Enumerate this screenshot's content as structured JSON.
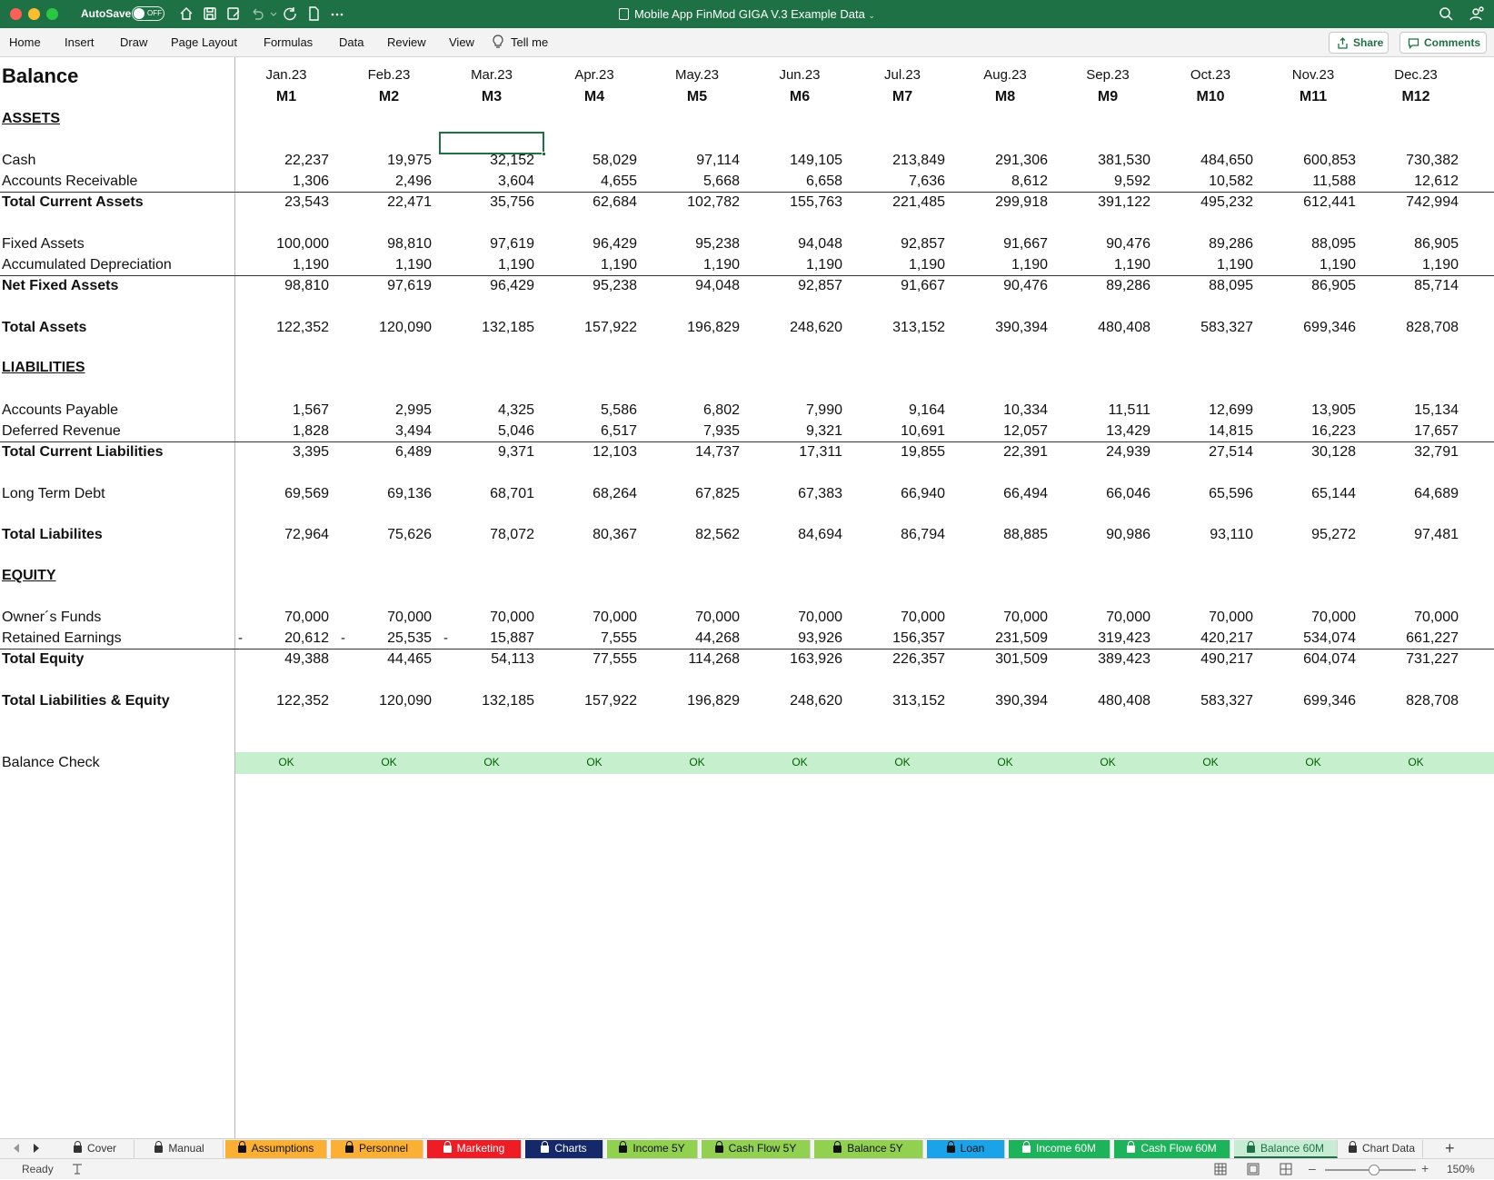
{
  "titlebar": {
    "autosave_label": "AutoSave",
    "autosave_state": "OFF",
    "document_title": "Mobile App FinMod GIGA V.3 Example Data",
    "bg_color": "#1e7145"
  },
  "ribbon": {
    "tabs": [
      "Home",
      "Insert",
      "Draw",
      "Page Layout",
      "Formulas",
      "Data",
      "Review",
      "View"
    ],
    "tell_me": "Tell me",
    "share_label": "Share",
    "comments_label": "Comments"
  },
  "sheet": {
    "title": "Balance",
    "months": [
      "Jan.23",
      "Feb.23",
      "Mar.23",
      "Apr.23",
      "May.23",
      "Jun.23",
      "Jul.23",
      "Aug.23",
      "Sep.23",
      "Oct.23",
      "Nov.23",
      "Dec.23"
    ],
    "month_ids": [
      "M1",
      "M2",
      "M3",
      "M4",
      "M5",
      "M6",
      "M7",
      "M8",
      "M9",
      "M10",
      "M11",
      "M12"
    ],
    "sections": {
      "assets": "ASSETS",
      "liabilities": "LIABILITIES",
      "equity": "EQUITY"
    },
    "rows": {
      "cash": {
        "label": "Cash",
        "values": [
          "22,237",
          "19,975",
          "32,152",
          "58,029",
          "97,114",
          "149,105",
          "213,849",
          "291,306",
          "381,530",
          "484,650",
          "600,853",
          "730,382"
        ]
      },
      "ar": {
        "label": "Accounts Receivable",
        "values": [
          "1,306",
          "2,496",
          "3,604",
          "4,655",
          "5,668",
          "6,658",
          "7,636",
          "8,612",
          "9,592",
          "10,582",
          "11,588",
          "12,612"
        ]
      },
      "tca": {
        "label": "Total Current Assets",
        "values": [
          "23,543",
          "22,471",
          "35,756",
          "62,684",
          "102,782",
          "155,763",
          "221,485",
          "299,918",
          "391,122",
          "495,232",
          "612,441",
          "742,994"
        ]
      },
      "fa": {
        "label": "Fixed Assets",
        "values": [
          "100,000",
          "98,810",
          "97,619",
          "96,429",
          "95,238",
          "94,048",
          "92,857",
          "91,667",
          "90,476",
          "89,286",
          "88,095",
          "86,905"
        ]
      },
      "ad": {
        "label": "Accumulated Depreciation",
        "values": [
          "1,190",
          "1,190",
          "1,190",
          "1,190",
          "1,190",
          "1,190",
          "1,190",
          "1,190",
          "1,190",
          "1,190",
          "1,190",
          "1,190"
        ]
      },
      "nfa": {
        "label": "Net Fixed Assets",
        "values": [
          "98,810",
          "97,619",
          "96,429",
          "95,238",
          "94,048",
          "92,857",
          "91,667",
          "90,476",
          "89,286",
          "88,095",
          "86,905",
          "85,714"
        ]
      },
      "ta": {
        "label": "Total Assets",
        "values": [
          "122,352",
          "120,090",
          "132,185",
          "157,922",
          "196,829",
          "248,620",
          "313,152",
          "390,394",
          "480,408",
          "583,327",
          "699,346",
          "828,708"
        ]
      },
      "ap": {
        "label": "Accounts Payable",
        "values": [
          "1,567",
          "2,995",
          "4,325",
          "5,586",
          "6,802",
          "7,990",
          "9,164",
          "10,334",
          "11,511",
          "12,699",
          "13,905",
          "15,134"
        ]
      },
      "dr": {
        "label": "Deferred Revenue",
        "values": [
          "1,828",
          "3,494",
          "5,046",
          "6,517",
          "7,935",
          "9,321",
          "10,691",
          "12,057",
          "13,429",
          "14,815",
          "16,223",
          "17,657"
        ]
      },
      "tcl": {
        "label": "Total Current Liabilities",
        "values": [
          "3,395",
          "6,489",
          "9,371",
          "12,103",
          "14,737",
          "17,311",
          "19,855",
          "22,391",
          "24,939",
          "27,514",
          "30,128",
          "32,791"
        ]
      },
      "ltd": {
        "label": "Long Term Debt",
        "values": [
          "69,569",
          "69,136",
          "68,701",
          "68,264",
          "67,825",
          "67,383",
          "66,940",
          "66,494",
          "66,046",
          "65,596",
          "65,144",
          "64,689"
        ]
      },
      "tl": {
        "label": "Total Liabilites",
        "values": [
          "72,964",
          "75,626",
          "78,072",
          "80,367",
          "82,562",
          "84,694",
          "86,794",
          "88,885",
          "90,986",
          "93,110",
          "95,272",
          "97,481"
        ]
      },
      "of": {
        "label": "Owner´s Funds",
        "values": [
          "70,000",
          "70,000",
          "70,000",
          "70,000",
          "70,000",
          "70,000",
          "70,000",
          "70,000",
          "70,000",
          "70,000",
          "70,000",
          "70,000"
        ]
      },
      "re": {
        "label": "Retained Earnings",
        "values": [
          "20,612",
          "25,535",
          "15,887",
          "7,555",
          "44,268",
          "93,926",
          "156,357",
          "231,509",
          "319,423",
          "420,217",
          "534,074",
          "661,227"
        ],
        "negative_marks": [
          "-",
          "-",
          "-"
        ]
      },
      "te": {
        "label": "Total Equity",
        "values": [
          "49,388",
          "44,465",
          "54,113",
          "77,555",
          "114,268",
          "163,926",
          "226,357",
          "301,509",
          "389,423",
          "490,217",
          "604,074",
          "731,227"
        ]
      },
      "tle": {
        "label": "Total Liabilities & Equity",
        "values": [
          "122,352",
          "120,090",
          "132,185",
          "157,922",
          "196,829",
          "248,620",
          "313,152",
          "390,394",
          "480,408",
          "583,327",
          "699,346",
          "828,708"
        ]
      },
      "bc": {
        "label": "Balance Check",
        "values": [
          "OK",
          "OK",
          "OK",
          "OK",
          "OK",
          "OK",
          "OK",
          "OK",
          "OK",
          "OK",
          "OK",
          "OK"
        ]
      }
    },
    "check_color": "#c6efce",
    "check_text_color": "#006100"
  },
  "sheet_tabs": [
    {
      "label": "Cover",
      "color": "#f3f3f3",
      "text": "#333",
      "locked": true
    },
    {
      "label": "Manual",
      "color": "#f3f3f3",
      "text": "#333",
      "locked": true
    },
    {
      "label": "Assumptions",
      "color": "#fbb034",
      "text": "#111",
      "locked": true
    },
    {
      "label": "Personnel",
      "color": "#fbb034",
      "text": "#111",
      "locked": true
    },
    {
      "label": "Marketing",
      "color": "#ee1c25",
      "text": "#fff",
      "locked": true
    },
    {
      "label": "Charts",
      "color": "#14286a",
      "text": "#fff",
      "locked": true
    },
    {
      "label": "Income 5Y",
      "color": "#92d050",
      "text": "#111",
      "locked": true
    },
    {
      "label": "Cash Flow 5Y",
      "color": "#92d050",
      "text": "#111",
      "locked": true
    },
    {
      "label": "Balance 5Y",
      "color": "#92d050",
      "text": "#111",
      "locked": true
    },
    {
      "label": "Loan",
      "color": "#1aa3e8",
      "text": "#111",
      "locked": true
    },
    {
      "label": "Income 60M",
      "color": "#1cb35b",
      "text": "#fff",
      "locked": true
    },
    {
      "label": "Cash Flow 60M",
      "color": "#1cb35b",
      "text": "#fff",
      "locked": true
    },
    {
      "label": "Balance 60M",
      "color": "#c7ecd4",
      "text": "#1e7145",
      "locked": true
    },
    {
      "label": "Chart Data",
      "color": "#f3f3f3",
      "text": "#333",
      "locked": true
    }
  ],
  "statusbar": {
    "ready": "Ready",
    "zoom": "150%"
  }
}
